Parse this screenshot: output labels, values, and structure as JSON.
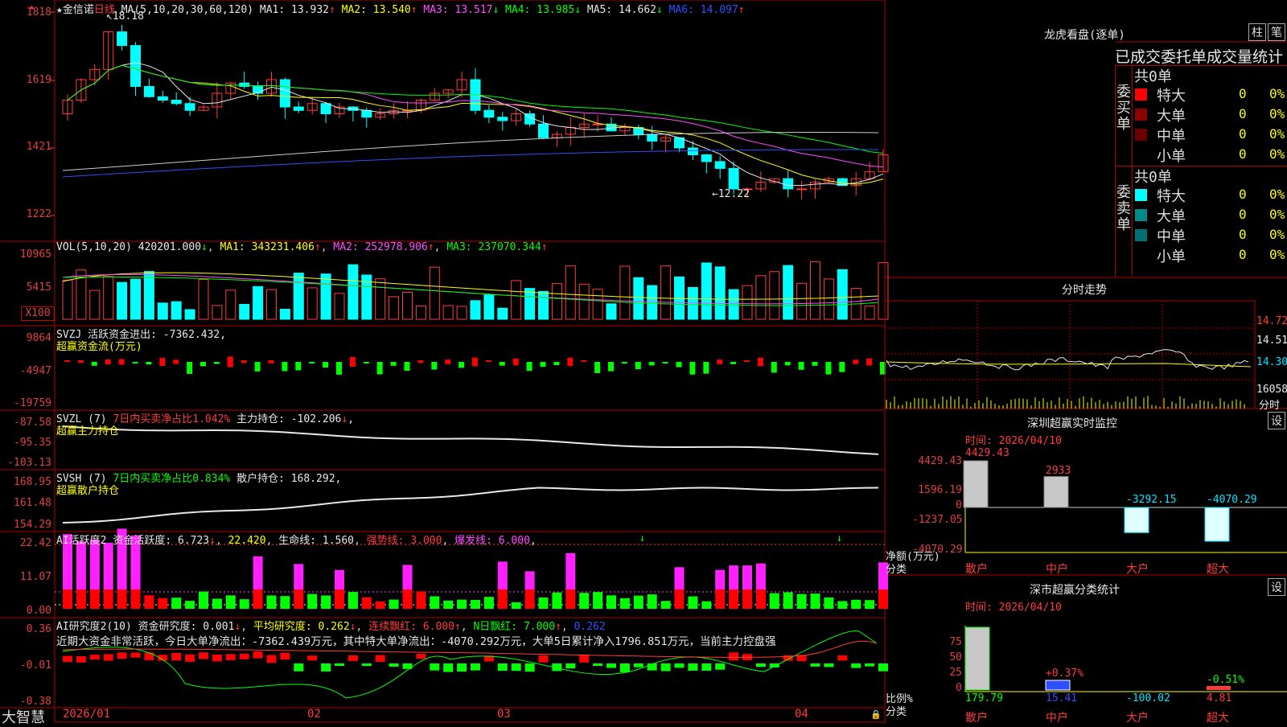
{
  "header": {
    "star": "★",
    "stock_name": "金信诺",
    "period": "日线",
    "ma_label": "MA(5,10,20,30,60,120)",
    "ma": [
      {
        "label": "MA1:",
        "value": "13.932",
        "arrow": "↑",
        "color": "#e8e8e8"
      },
      {
        "label": "MA2:",
        "value": "13.540",
        "arrow": "↑",
        "color": "#ffff00"
      },
      {
        "label": "MA3:",
        "value": "13.517",
        "arrow": "↓",
        "color": "#ff4dff"
      },
      {
        "label": "MA4:",
        "value": "13.985",
        "arrow": "↓",
        "color": "#00ff00"
      },
      {
        "label": "MA5:",
        "value": "14.662",
        "arrow": "↓",
        "color": "#e8e8e8"
      },
      {
        "label": "MA6:",
        "value": "14.097",
        "arrow": "↑",
        "color": "#3050ff"
      }
    ]
  },
  "price_axis": [
    "1818",
    "1619",
    "1421",
    "1222"
  ],
  "price_marks": {
    "high": "18.18",
    "low": "12.22"
  },
  "vol": {
    "label": "VOL(5,10,20)",
    "value": "420201.000",
    "ma1": "343231.406",
    "ma2": "252978.906",
    "ma3": "237070.344",
    "axis": [
      "10965",
      "5415",
      "X100"
    ]
  },
  "svzj": {
    "label": "SVZJ",
    "text": "活跃资金进出: -7362.432",
    "title": "超赢资金流(万元)",
    "axis": [
      "9864",
      "-4947",
      "-19759"
    ]
  },
  "svzl": {
    "label": "SVZL (7)",
    "text1": "7日内买卖净占比1.042%",
    "text2": "主力持仓: -102.206",
    "title": "超赢主力持仓",
    "axis": [
      "-87.58",
      "-95.35",
      "-103.13"
    ]
  },
  "svsh": {
    "label": "SVSH (7)",
    "text1": "7日内买卖净占比0.834%",
    "text2": "散户持仓: 168.292",
    "title": "超赢散户持仓",
    "axis": [
      "168.95",
      "161.48",
      "154.29"
    ]
  },
  "ai1": {
    "label": "AI活跃度2",
    "t1": "资金活跃度: 6.723",
    "t2": "22.420",
    "t3": "生命线: 1.560",
    "t4": "强势线: 3.000",
    "t5": "爆发线: 6.000",
    "axis": [
      "22.42",
      "11.07",
      "0.00"
    ]
  },
  "ai2": {
    "label": "AI研究度2(10)",
    "t1": "资金研究度: 0.001",
    "t2": "平均研究度: 0.262",
    "t3": "连续飘红: 6.000",
    "t4": "N日飘红: 7.000",
    "t5": "0.262",
    "comment": "近期大资金非常活跃，今日大单净流出：-7362.439万元，其中特大单净流出：-4070.292万元，大单5日累计净入1796.851万元，当前主力控盘强",
    "axis": [
      "0.36",
      "-0.01",
      "-0.38"
    ]
  },
  "bottom": {
    "brand": "大智慧",
    "dates": [
      "2026/01",
      "02",
      "03",
      "04"
    ]
  },
  "lhkp": {
    "title": "龙虎看盘(逐单)",
    "btn1": "柱",
    "btn2": "笔",
    "sub": "已成交委托单成交量统计",
    "buy_label": "委买单",
    "sell_label": "委卖单",
    "buy_total": "共0单",
    "sell_total": "共0单",
    "buy_rows": [
      {
        "name": "特大",
        "count": "0",
        "pct": "0%",
        "color": "#ff0000"
      },
      {
        "name": "大单",
        "count": "0",
        "pct": "0%",
        "color": "#8b0000"
      },
      {
        "name": "中单",
        "count": "0",
        "pct": "0%",
        "color": "#6a0000"
      },
      {
        "name": "小单",
        "count": "0",
        "pct": "0%",
        "color": ""
      }
    ],
    "sell_rows": [
      {
        "name": "特大",
        "count": "0",
        "pct": "0%",
        "color": "#00ffff"
      },
      {
        "name": "大单",
        "count": "0",
        "pct": "0%",
        "color": "#008b8b"
      },
      {
        "name": "中单",
        "count": "0",
        "pct": "0%",
        "color": "#007070"
      },
      {
        "name": "小单",
        "count": "0",
        "pct": "0%",
        "color": ""
      }
    ]
  },
  "fenshi": {
    "title": "分时走势",
    "axis": [
      "14.72",
      "14.51",
      "14.30",
      "16058",
      "分时"
    ]
  },
  "sz_monitor": {
    "title": "深圳超赢实时监控",
    "btn": "设",
    "time": "时间: 2026/04/10",
    "axis": [
      "4429.43",
      "1596.19",
      "0",
      "-1237.05",
      "-4070.29"
    ],
    "ylabel": "净额(万元)",
    "xlabel": "分类",
    "values": [
      "4429.43",
      "2933",
      "-3292.15",
      "-4070.29"
    ],
    "categories": [
      "散户",
      "中户",
      "大户",
      "超大"
    ]
  },
  "sz_class": {
    "title": "深市超赢分类统计",
    "btn": "设",
    "time": "时间: 2026/04/10",
    "axis": [
      "75",
      "50",
      "25",
      "0"
    ],
    "ylabel": "比例%",
    "xlabel": "分类",
    "values": [
      "179.79",
      "15.41",
      "-100.02",
      "4.81"
    ],
    "changes": [
      "",
      "+0.37%",
      "",
      "-0.51%"
    ],
    "categories": [
      "散户",
      "中户",
      "大户",
      "超大"
    ]
  },
  "chart_data": {
    "type": "bar",
    "title": "深圳超赢实时监控",
    "categories": [
      "散户",
      "中户",
      "大户",
      "超大"
    ],
    "values": [
      4429.43,
      2933,
      -3292.15,
      -4070.29
    ],
    "ylabel": "净额(万元)",
    "ylim": [
      -4070.29,
      4429.43
    ]
  }
}
